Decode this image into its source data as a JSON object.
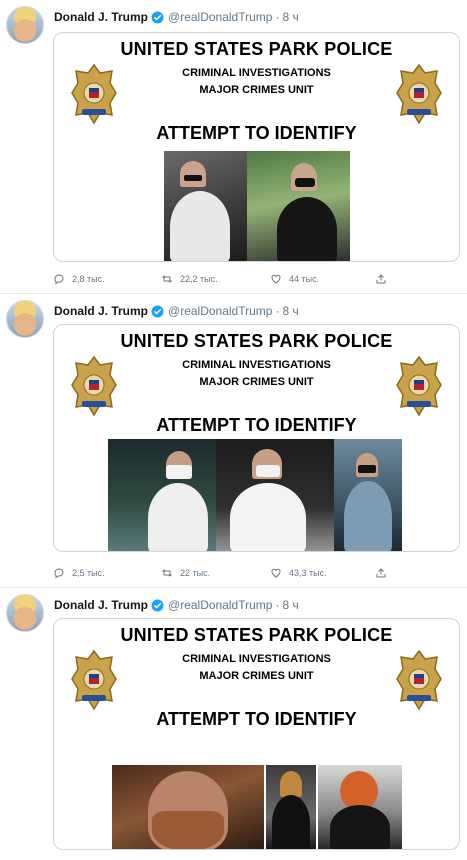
{
  "tweets": [
    {
      "author": "Donald J. Trump",
      "handle": "@realDonaldTrump",
      "time": "8 ч",
      "image": {
        "title": "UNITED STATES PARK POLICE",
        "line1": "CRIMINAL INVESTIGATIONS",
        "line2": "MAJOR CRIMES UNIT",
        "headline": "ATTEMPT TO IDENTIFY"
      },
      "replies": "2,8 тыс.",
      "retweets": "22,2 тыс.",
      "likes": "44 тыс."
    },
    {
      "author": "Donald J. Trump",
      "handle": "@realDonaldTrump",
      "time": "8 ч",
      "image": {
        "title": "UNITED STATES PARK POLICE",
        "line1": "CRIMINAL INVESTIGATIONS",
        "line2": "MAJOR CRIMES UNIT",
        "headline": "ATTEMPT TO IDENTIFY"
      },
      "replies": "2,5 тыс.",
      "retweets": "22 тыс.",
      "likes": "43,3 тыс."
    },
    {
      "author": "Donald J. Trump",
      "handle": "@realDonaldTrump",
      "time": "8 ч",
      "image": {
        "title": "UNITED STATES PARK POLICE",
        "line1": "CRIMINAL INVESTIGATIONS",
        "line2": "MAJOR CRIMES UNIT",
        "headline": "ATTEMPT TO IDENTIFY"
      }
    }
  ],
  "separator": "·",
  "colors": {
    "verified": "#1da1f2",
    "meta": "#657786",
    "border": "#ccd6dd"
  },
  "icons": [
    "verified-badge-icon",
    "reply-icon",
    "retweet-icon",
    "like-icon",
    "share-icon",
    "police-badge-icon"
  ]
}
